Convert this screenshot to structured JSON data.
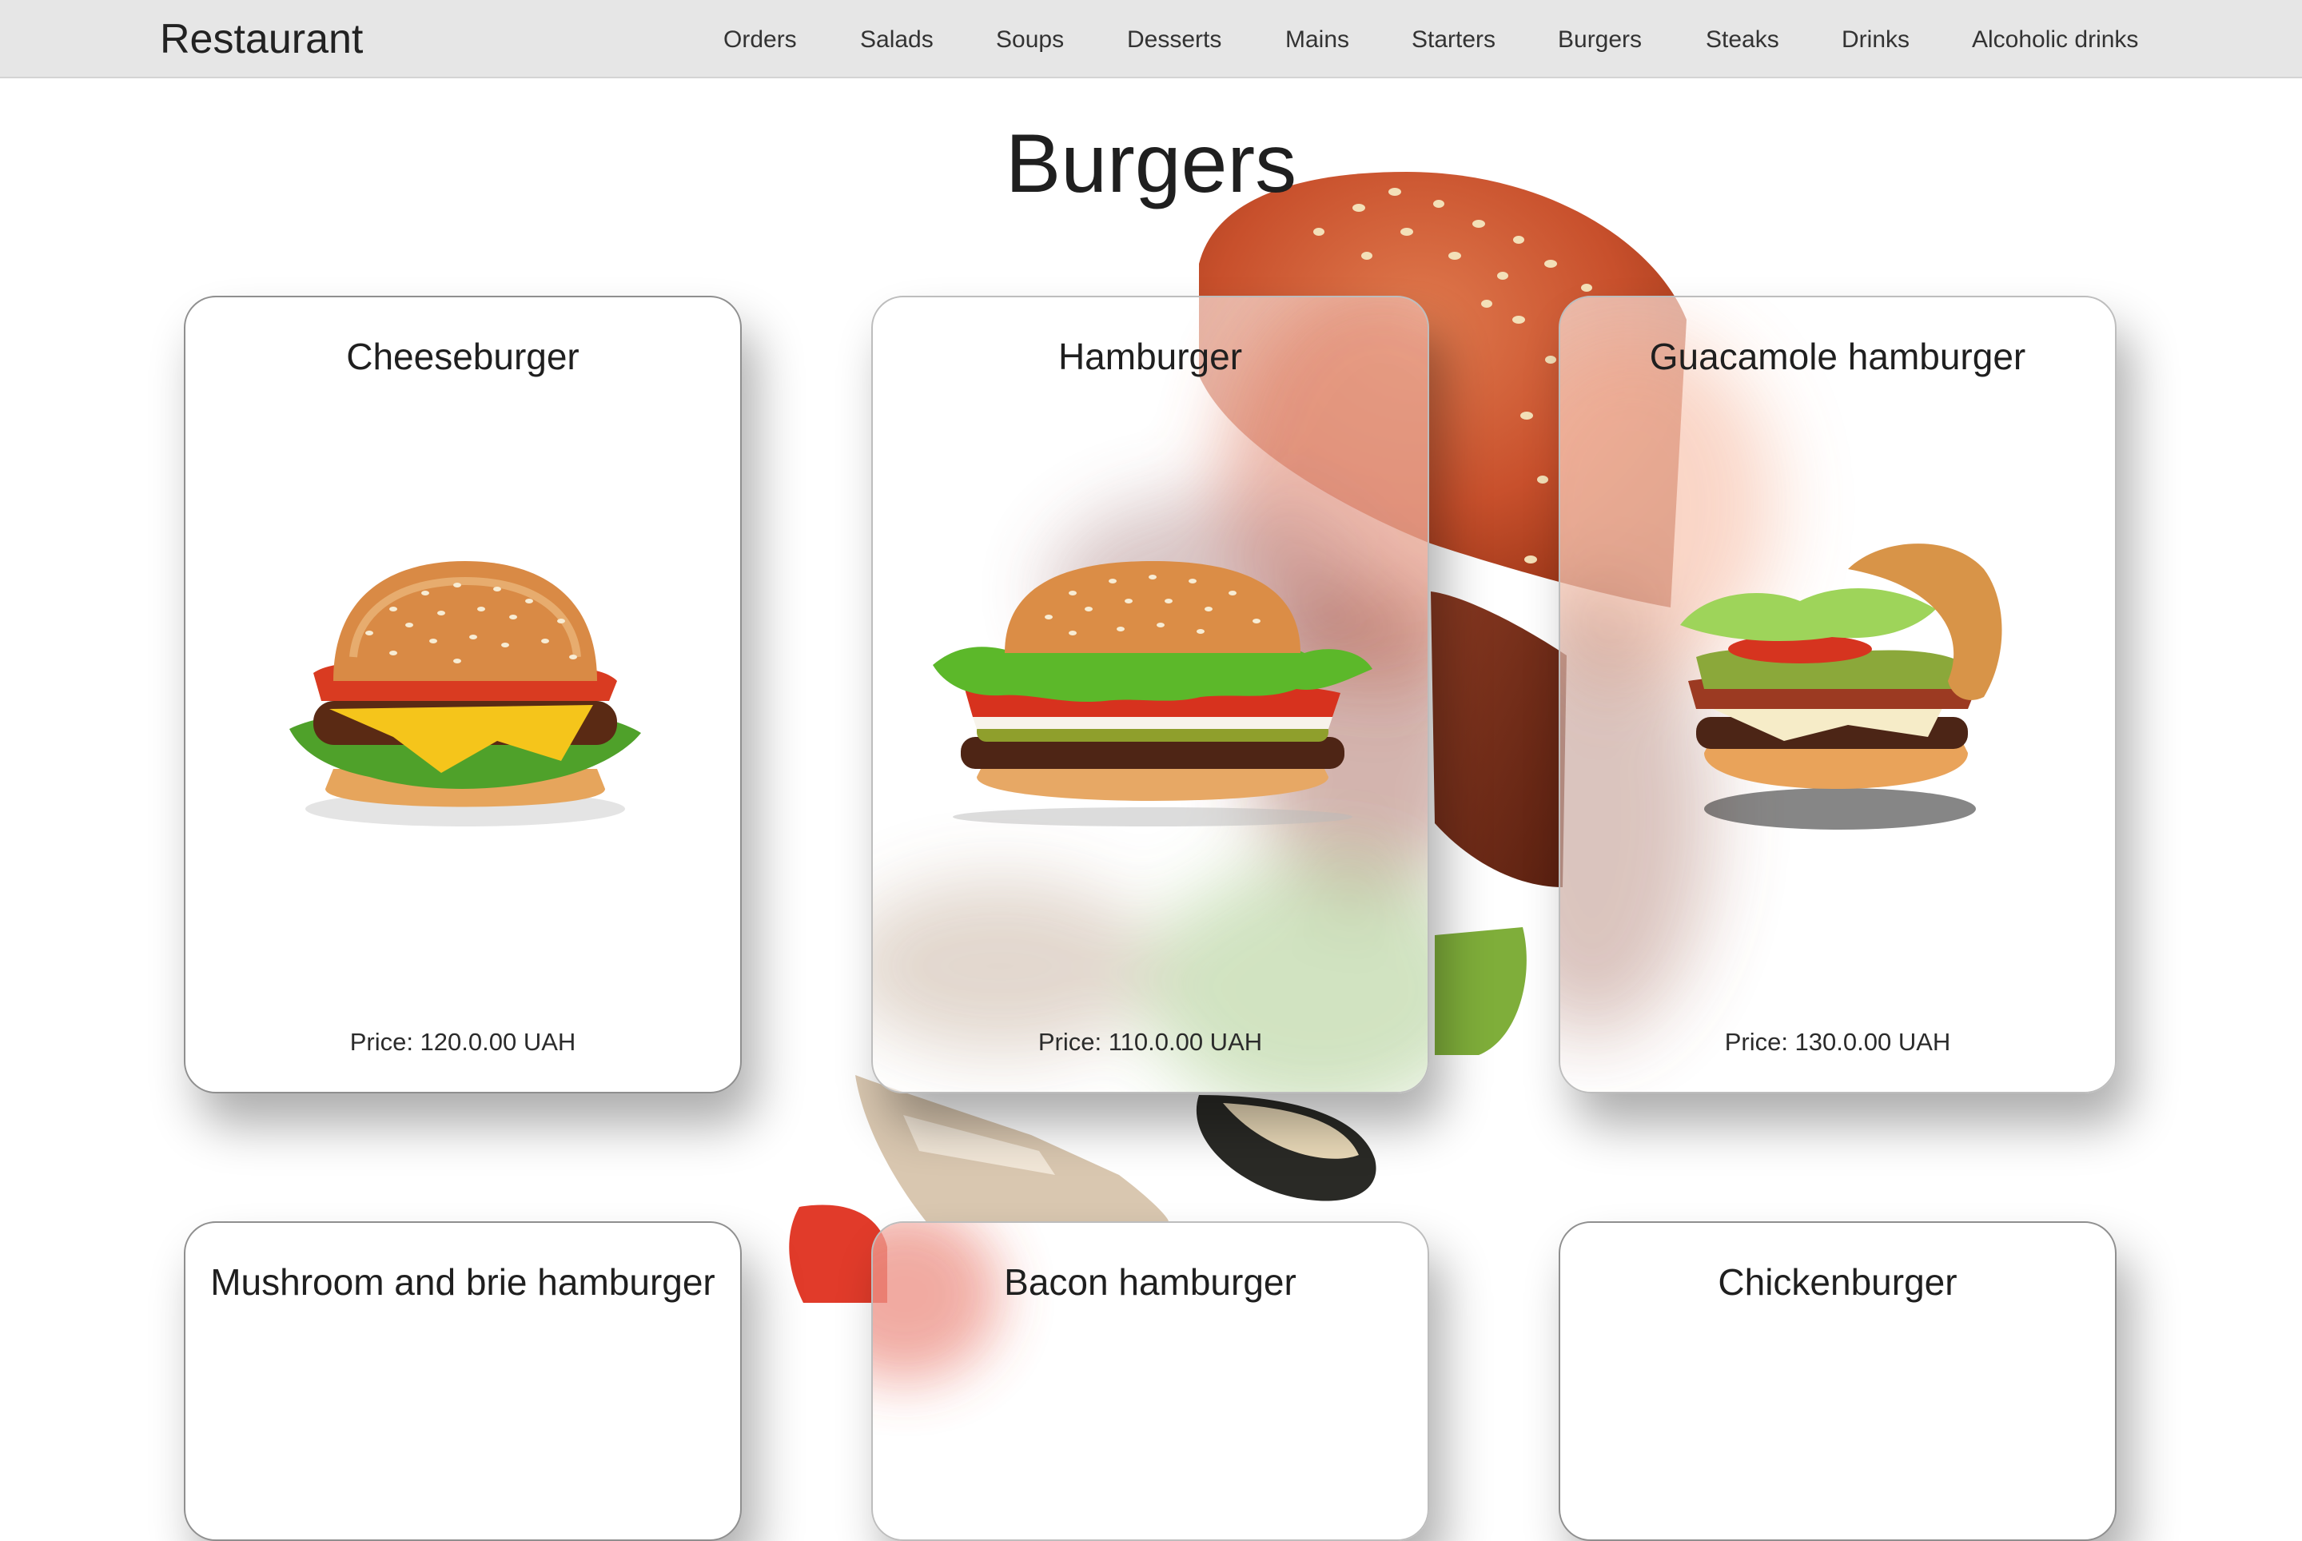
{
  "navbar": {
    "brand": "Restaurant",
    "items": [
      "Orders",
      "Salads",
      "Soups",
      "Desserts",
      "Mains",
      "Starters",
      "Burgers",
      "Steaks",
      "Drinks",
      "Alcoholic drinks"
    ]
  },
  "page": {
    "title": "Burgers"
  },
  "products": [
    {
      "name": "Cheeseburger",
      "price": "Price: 120.0.00 UAH"
    },
    {
      "name": "Hamburger",
      "price": "Price: 110.0.00 UAH"
    },
    {
      "name": "Guacamole hamburger",
      "price": "Price: 130.0.00 UAH"
    },
    {
      "name": "Mushroom and brie hamburger",
      "price": ""
    },
    {
      "name": "Bacon hamburger",
      "price": ""
    },
    {
      "name": "Chickenburger",
      "price": ""
    }
  ],
  "colors": {
    "navbar_bg": "#e6e6e6",
    "card_border": "#8f8f8f",
    "text": "#1f1f1f"
  }
}
